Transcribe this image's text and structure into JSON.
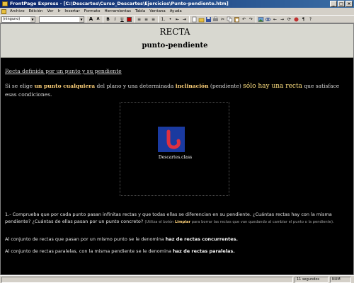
{
  "window": {
    "title": "FrontPage Express - [C:\\Descartes\\Curso_Descartes\\Ejercicios\\Punto-pendiente.htm]",
    "controls": [
      "_",
      "□",
      "×"
    ]
  },
  "menu": [
    "Archivo",
    "Edición",
    "Ver",
    "Ir",
    "Insertar",
    "Formato",
    "Herramientas",
    "Tabla",
    "Ventana",
    "Ayuda"
  ],
  "toolbar": {
    "style_value": "(ninguno)",
    "font_value": "",
    "size_up": "A",
    "size_down": "A",
    "bold": "B",
    "italic": "I",
    "underline": "U",
    "align_left": "≡",
    "align_center": "≡",
    "align_right": "≡",
    "list_num": "1.",
    "list_bullet": "•",
    "indent_less": "⇤",
    "indent_more": "⇥",
    "paragraph": "¶",
    "color_accent": "#c00000"
  },
  "document": {
    "title": "RECTA",
    "subtitle": "punto-pendiente",
    "section_link": "Recta definida por un punto y su pendiente",
    "intro": {
      "t1": "Si se elige ",
      "b1": "un punto cualquiera",
      "t2": " del plano y una determinada ",
      "b2": "inclinación",
      "t3": " (pendiente) ",
      "b3": "sólo hay una recta",
      "t4": " que satisface esas condiciones."
    },
    "applet_label": "Descartes.class",
    "question": {
      "t1": "1.- Comprueba que por cada punto pasan infinitas rectas y que todas ellas se diferencian en su pendiente. ¿Cuántas rectas hay con la misma pendiente? ¿Cuántas de ellas pasan por un punto concreto? ",
      "note1": "(Utiliza el botón ",
      "note_b": "Limpiar",
      "note2": " para borrar las rectas que van quedando al cambiar el punto o la pendiente)."
    },
    "p2": {
      "t1": "Al conjunto de rectas que pasan por un mismo punto se le denomina ",
      "b1": "haz de rectas concurrentes."
    },
    "p3": {
      "t1": "Al conjunto de rectas paralelas, con la misma pendiente se le denomina ",
      "b1": "haz de rectas paralelas."
    }
  },
  "status": {
    "time": "11 segundos",
    "num": "NUM"
  },
  "colors": {
    "title_bar": "#0a246a",
    "page_bg": "#000000",
    "highlight": "#ffd27a",
    "logo_bg": "#1a3aa0",
    "logo_mark": "#e03040"
  }
}
